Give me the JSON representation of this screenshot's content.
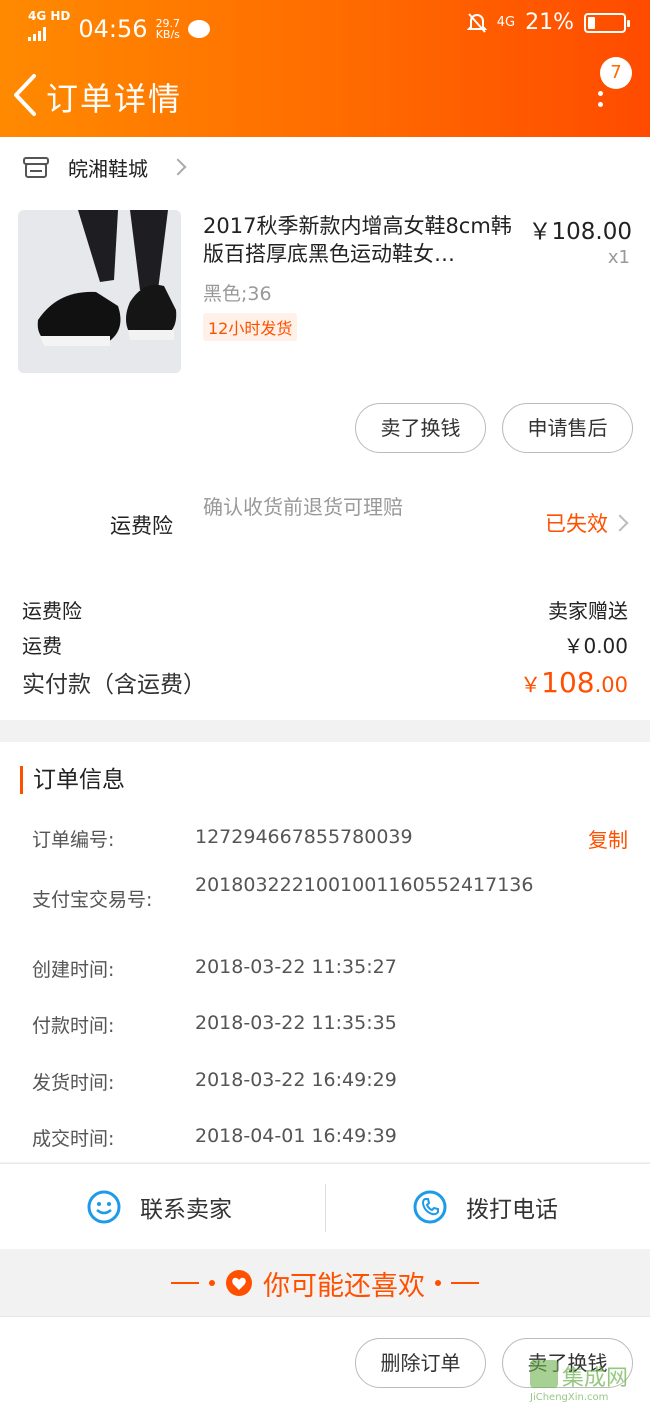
{
  "status_bar": {
    "network": "4G HD",
    "time": "04:56",
    "speed_value": "29.7",
    "speed_unit": "KB/s",
    "network_right": "4G",
    "battery": "21%",
    "battery_level": 0.21
  },
  "header": {
    "title": "订单详情",
    "badge_count": "7"
  },
  "shop": {
    "name": "皖湘鞋城"
  },
  "product": {
    "title": "2017秋季新款内增高女鞋8cm韩版百搭厚底黑色运动鞋女…",
    "price": "￥108.00",
    "quantity": "x1",
    "sku": "黑色;36",
    "ship_tag": "12小时发货"
  },
  "actions": {
    "sell_button": "卖了换钱",
    "after_sale_button": "申请售后"
  },
  "insurance": {
    "label": "运费险",
    "description": "确认收货前退货可理赔",
    "status": "已失效"
  },
  "fees": {
    "insurance_label": "运费险",
    "insurance_value": "卖家赠送",
    "shipping_label": "运费",
    "shipping_value": "￥0.00",
    "total_label": "实付款（含运费）",
    "total_symbol": "￥",
    "total_integer": "108",
    "total_decimal": ".00"
  },
  "order_info": {
    "title": "订单信息",
    "copy_label": "复制",
    "rows": [
      {
        "label": "订单编号:",
        "value": "127294667855780039"
      },
      {
        "label": "支付宝交易号:",
        "value": "2018032221001001160552417136"
      },
      {
        "label": "创建时间:",
        "value": "2018-03-22 11:35:27"
      },
      {
        "label": "付款时间:",
        "value": "2018-03-22 11:35:35"
      },
      {
        "label": "发货时间:",
        "value": "2018-03-22 16:49:29"
      },
      {
        "label": "成交时间:",
        "value": "2018-04-01 16:49:39"
      }
    ]
  },
  "contact": {
    "seller_label": "联系卖家",
    "phone_label": "拨打电话"
  },
  "recommend": {
    "title": "你可能还喜欢"
  },
  "bottom_bar": {
    "delete_button": "删除订单",
    "sell_button": "卖了换钱"
  },
  "watermark": {
    "text": "集成网",
    "url": "JiChengXin.com"
  },
  "colors": {
    "accent": "#ff5000",
    "header_start": "#ff8a00",
    "header_end": "#ff4b00"
  }
}
